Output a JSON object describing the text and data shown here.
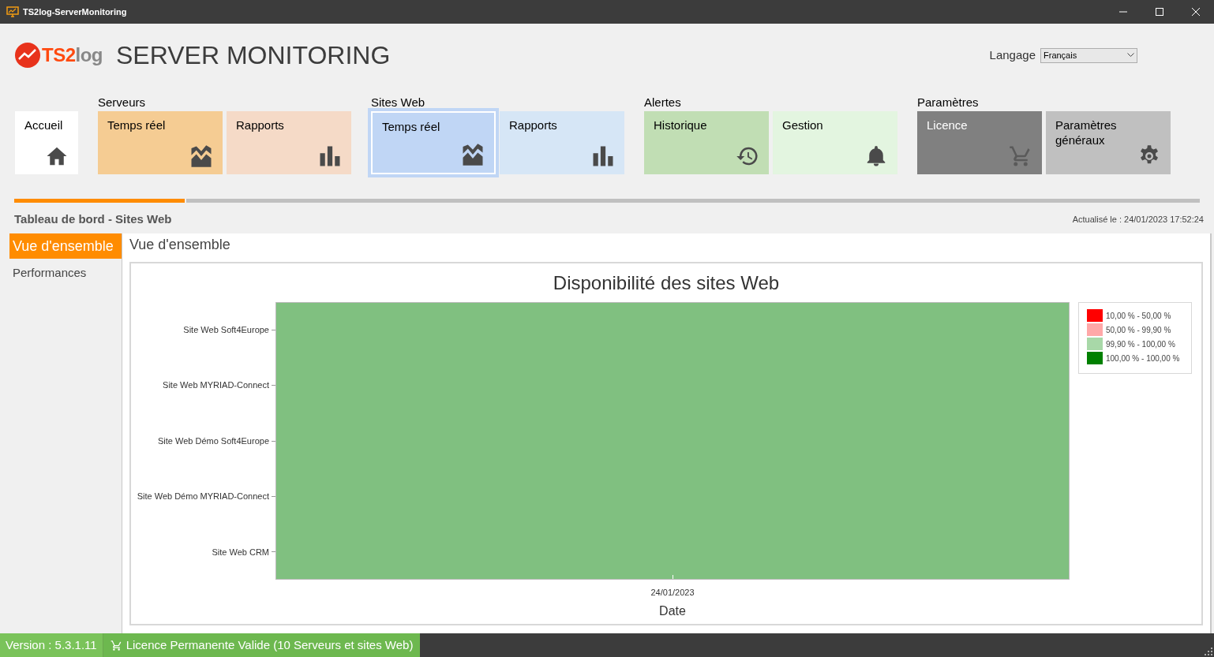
{
  "window": {
    "title": "TS2log-ServerMonitoring"
  },
  "header": {
    "logo_text": "TS2log",
    "title": "SERVER MONITORING",
    "language_label": "Langage",
    "language_value": "Français"
  },
  "home_tile": {
    "label": "Accueil",
    "kind": "home",
    "selected": false
  },
  "groups": [
    {
      "label": "Serveurs",
      "tiles": [
        {
          "label": "Temps réel",
          "kind": "realtime",
          "color": "#f5cc93",
          "selected": false
        },
        {
          "label": "Rapports",
          "kind": "reports",
          "color": "#f5dac7",
          "selected": false
        }
      ]
    },
    {
      "label": "Sites Web",
      "tiles": [
        {
          "label": "Temps réel",
          "kind": "realtime",
          "color": "#c0d6f5",
          "selected": true
        },
        {
          "label": "Rapports",
          "kind": "reports",
          "color": "#d6e6f6",
          "selected": false
        }
      ]
    },
    {
      "label": "Alertes",
      "tiles": [
        {
          "label": "Historique",
          "kind": "history",
          "color": "#c1deb4",
          "selected": false
        },
        {
          "label": "Gestion",
          "kind": "bell",
          "color": "#e3f5e0",
          "selected": false
        }
      ]
    },
    {
      "label": "Paramètres",
      "tiles": [
        {
          "label": "Licence",
          "kind": "cart",
          "color": "#808080",
          "selected": false
        },
        {
          "label": "Paramètres généraux",
          "kind": "gear",
          "color": "#c0c0c0",
          "selected": false
        }
      ]
    }
  ],
  "progress": {
    "level": 0.145
  },
  "breadcrumb": "Tableau de bord - Sites Web",
  "updated": "Actualisé le : 24/01/2023 17:52:24",
  "sidebar": {
    "items": [
      {
        "label": "Vue d'ensemble",
        "selected": true
      },
      {
        "label": "Performances",
        "selected": false
      }
    ]
  },
  "panel": {
    "title": "Vue d'ensemble",
    "chart": {
      "title": "Disponibilité des sites Web",
      "sites": [
        {
          "label": "Site Web Soft4Europe",
          "color": "#80c080"
        },
        {
          "label": "Site Web MYRIAD-Connect",
          "color": "#80c080"
        },
        {
          "label": "Site Web Démo Soft4Europe",
          "color": "#80c080"
        },
        {
          "label": "Site Web Démo MYRIAD-Connect",
          "color": "#80c080"
        },
        {
          "label": "Site Web CRM",
          "color": "#80c080"
        }
      ],
      "x_tick": "24/01/2023",
      "xlabel": "Date",
      "legend": [
        {
          "label": "10,00 % - 50,00 %",
          "color": "#ff0000"
        },
        {
          "label": "50,00 % - 99,90 %",
          "color": "#ffa8a8"
        },
        {
          "label": "99,90 % - 100,00 %",
          "color": "#a8d8a8"
        },
        {
          "label": "100,00 % - 100,00 %",
          "color": "#008000"
        }
      ]
    }
  },
  "status_bar": {
    "version": "Version : 5.3.1.11",
    "license": "Licence Permanente Valide (10 Serveurs et sites Web)"
  }
}
